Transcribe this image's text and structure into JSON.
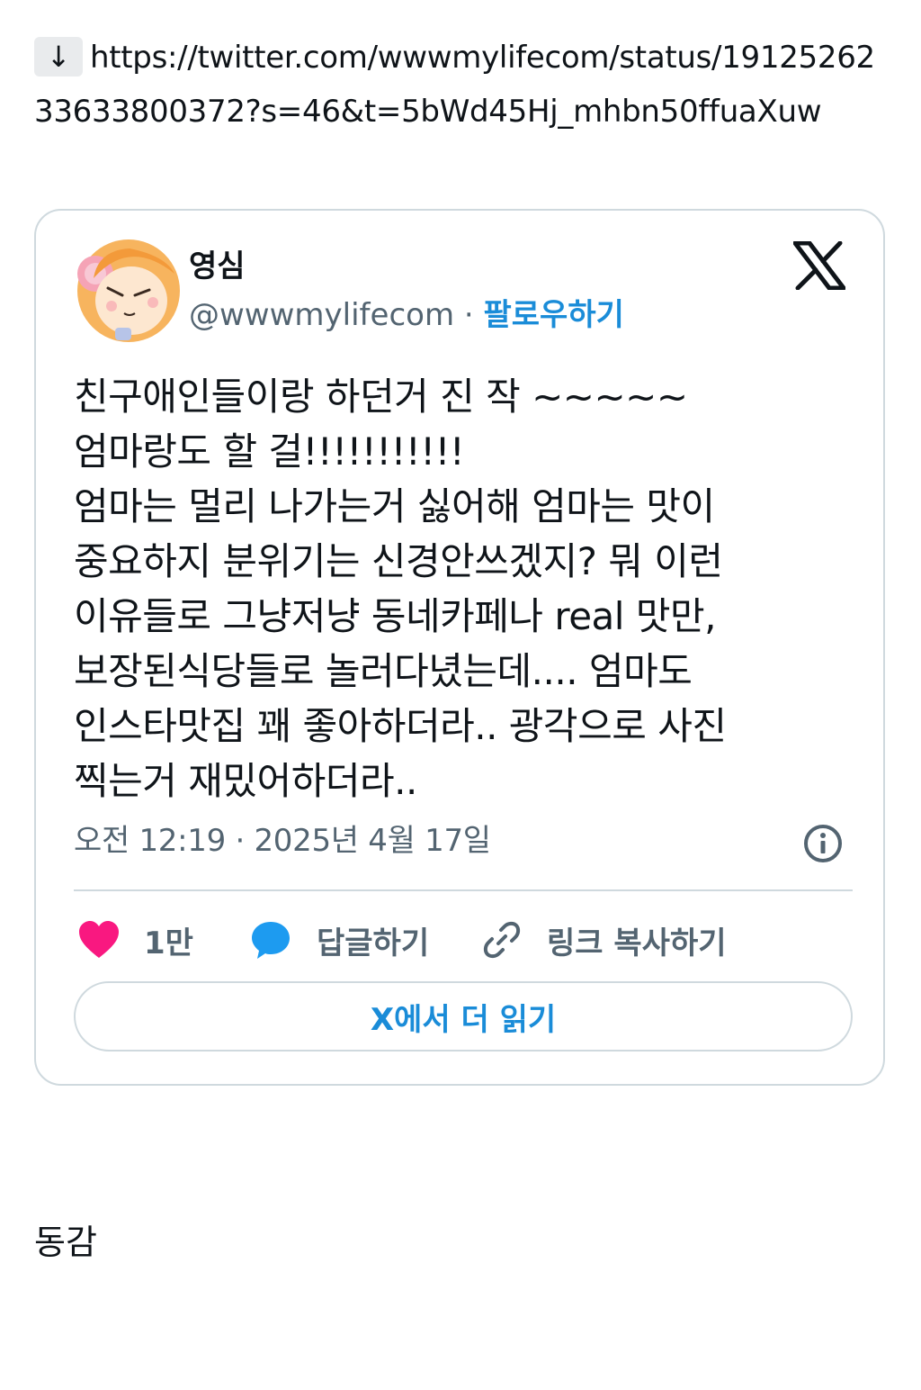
{
  "link": {
    "arrow_icon": "↓",
    "url": "https://twitter.com/wwwmylifecom/status/1912526233633800372?s=46&t=5bWd45Hj_mhbn50ffuaXuw"
  },
  "tweet": {
    "author_name": "영심",
    "handle": "@wwwmylifecom",
    "separator": "·",
    "follow_label": "팔로우하기",
    "text": "친구애인들이랑 하던거 진 작  ~~~~~\n엄마랑도 할 걸!!!!!!!!!!!\n엄마는 멀리 나가는거 싫어해 엄마는 맛이\n중요하지 분위기는 신경안쓰겠지? 뭐 이런\n이유들로 그냥저냥 동네카페나 real 맛만,\n보장된식당들로 놀러다녔는데.... 엄마도\n인스타맛집 꽤 좋아하더라.. 광각으로 사진\n찍는거 재밌어하더라..",
    "timestamp": "오전 12:19 · 2025년 4월 17일",
    "likes_count": "1만",
    "reply_label": "답글하기",
    "copy_link_label": "링크 복사하기",
    "read_more_label": "X에서 더 읽기"
  },
  "comment": "동감",
  "colors": {
    "text": "#0f1419",
    "secondary": "#536471",
    "link_blue": "#1a8cd8",
    "heart": "#f91880",
    "reply_blue": "#1d9bf0",
    "border": "#cfd9de"
  },
  "icons": [
    "down-arrow-icon",
    "avatar",
    "x-logo-icon",
    "info-icon",
    "heart-icon",
    "reply-bubble-icon",
    "link-icon"
  ]
}
